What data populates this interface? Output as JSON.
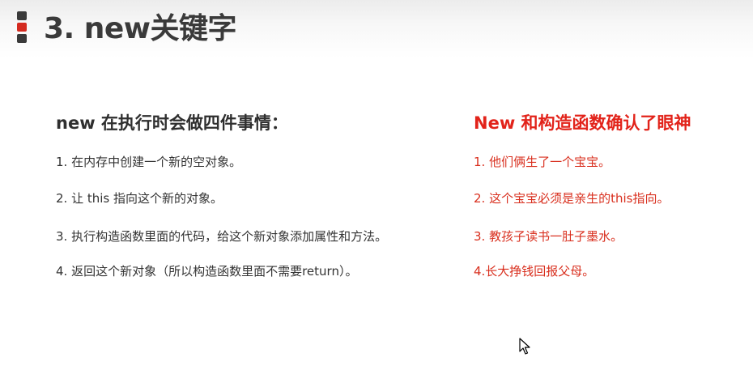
{
  "slide": {
    "title": "3. new关键字"
  },
  "left_column": {
    "heading": "new 在执行时会做四件事情：",
    "items": [
      "1. 在内存中创建一个新的空对象。",
      "2. 让 this 指向这个新的对象。",
      "3. 执行构造函数里面的代码，给这个新对象添加属性和方法。",
      "4. 返回这个新对象（所以构造函数里面不需要return）。"
    ]
  },
  "right_column": {
    "heading": "New 和构造函数确认了眼神",
    "items": [
      "1. 他们俩生了一个宝宝。",
      "2. 这个宝宝必须是亲生的this指向。",
      "3. 教孩子读书一肚子墨水。",
      "4.长大挣钱回报父母。"
    ]
  },
  "colors": {
    "title": "#3a3a3a",
    "accent_red": "#e2231a",
    "body_text": "#333333",
    "right_text": "#d9301f"
  },
  "icons": {
    "title_marker": "stacked-squares-icon",
    "cursor": "mouse-pointer-icon"
  }
}
